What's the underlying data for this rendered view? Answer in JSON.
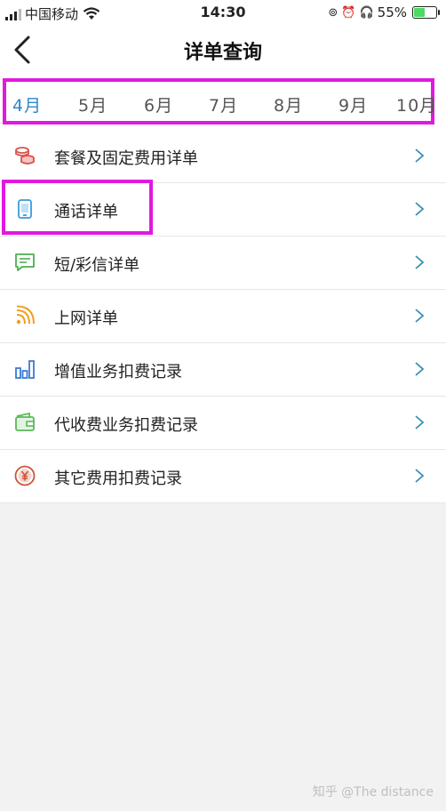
{
  "status_bar": {
    "carrier": "中国移动",
    "time": "14:30",
    "battery_text": "55%",
    "battery_level": 0.55,
    "icons": [
      "signal-icon",
      "wifi-icon",
      "rotation-lock-icon",
      "alarm-icon",
      "headphones-icon",
      "battery-icon"
    ]
  },
  "nav": {
    "title": "详单查询",
    "back_icon": "chevron-left-icon"
  },
  "month_tabs": {
    "items": [
      "4月",
      "5月",
      "6月",
      "7月",
      "8月",
      "9月",
      "10月"
    ],
    "selected": "4月",
    "highlight_color": "#e019e0"
  },
  "menu": {
    "items": [
      {
        "label": "套餐及固定费用详单",
        "icon": "coins-icon"
      },
      {
        "label": "通话详单",
        "icon": "phone-icon"
      },
      {
        "label": "短/彩信详单",
        "icon": "message-icon"
      },
      {
        "label": "上网详单",
        "icon": "wifi-signal-icon"
      },
      {
        "label": "增值业务扣费记录",
        "icon": "bar-chart-icon"
      },
      {
        "label": "代收费业务扣费记录",
        "icon": "wallet-icon"
      },
      {
        "label": "其它费用扣费记录",
        "icon": "yuan-coin-icon"
      }
    ],
    "chevron_icon": "chevron-right-icon"
  },
  "colors": {
    "accent": "#2f86c9",
    "highlight": "#e019e0",
    "coins": "#d9534f",
    "phone": "#3a9ad9",
    "message": "#4caf50",
    "wifi": "#f0a020",
    "chart": "#3a7bd5",
    "wallet": "#5cb85c",
    "yuan": "#c9553a"
  },
  "watermark": "知乎 @The distance"
}
